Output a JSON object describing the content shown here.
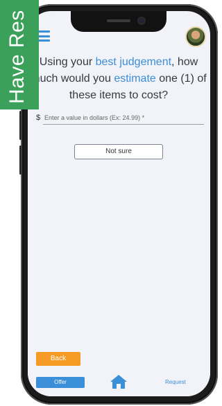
{
  "banner": {
    "text": "Have Res"
  },
  "header": {
    "menu_icon": "hamburger-menu-icon",
    "avatar_icon": "user-avatar"
  },
  "question": {
    "part1": "Using your ",
    "part2": "best judgement",
    "part3": ", how much would you ",
    "part4": "estimate",
    "part5": " one (1) of these items to cost?"
  },
  "input": {
    "currency": "$",
    "placeholder": "Enter a value in dollars (Ex: 24.99) *"
  },
  "buttons": {
    "not_sure": "Not sure",
    "back": "Back"
  },
  "tabbar": {
    "offer": "Offer",
    "home_icon": "home-icon",
    "request": "Request"
  },
  "colors": {
    "accent": "#3b8ed8",
    "back": "#f59a25",
    "banner": "#3aa05a"
  }
}
